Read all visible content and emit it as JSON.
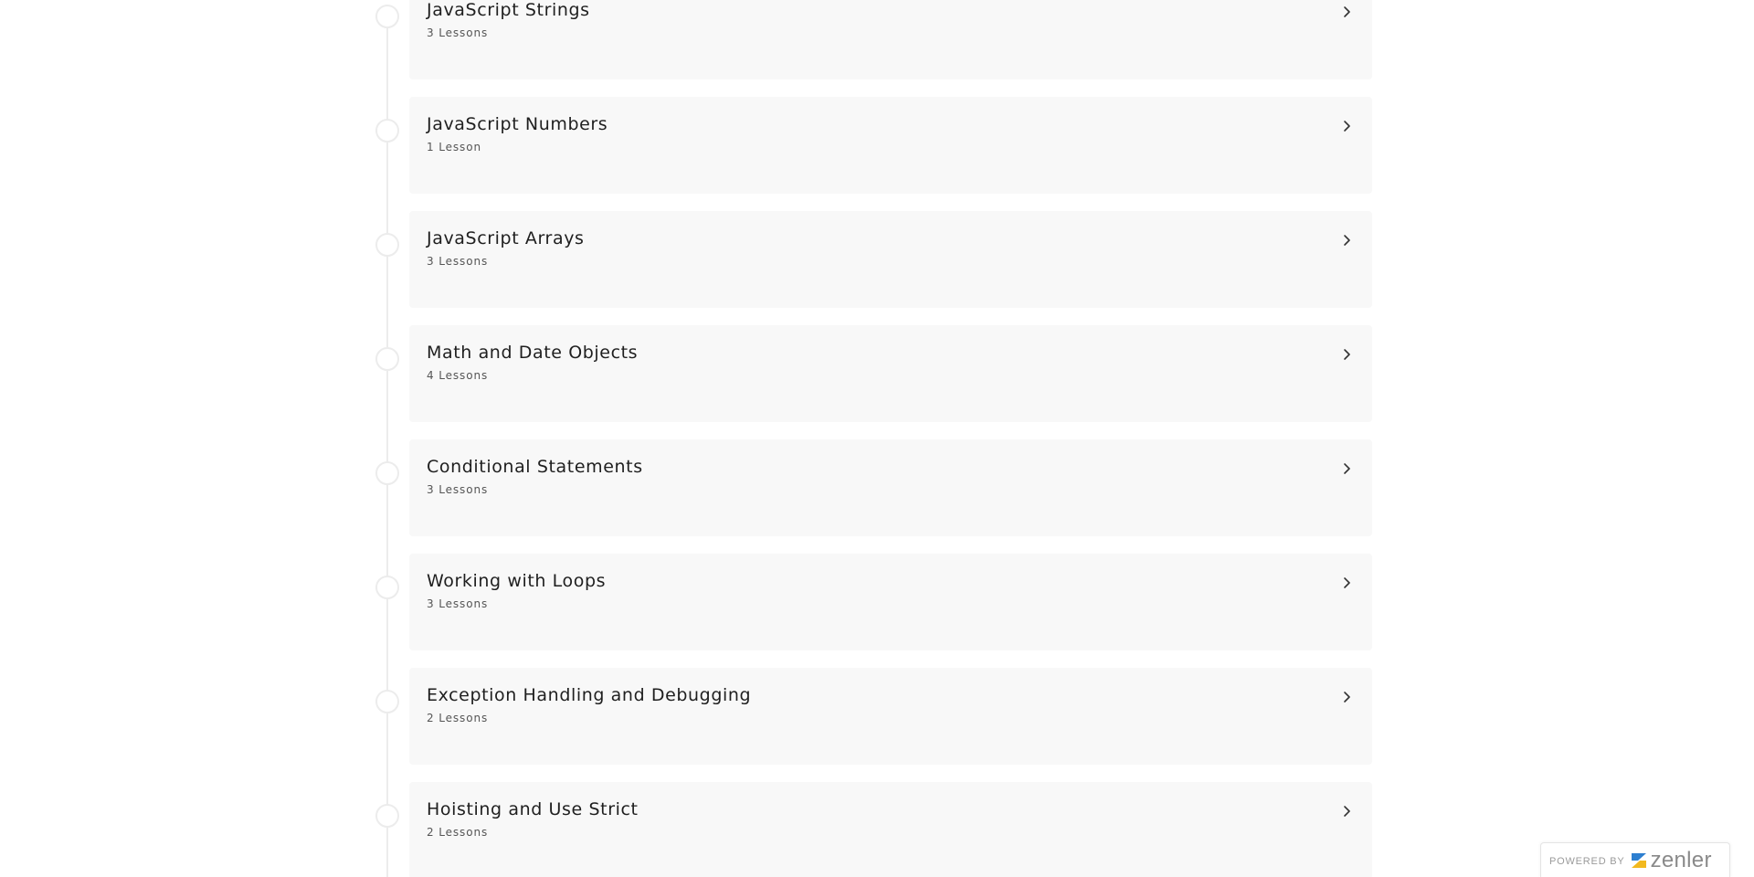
{
  "sections": [
    {
      "title": "JavaScript Strings",
      "count": "3 Lessons"
    },
    {
      "title": "JavaScript Numbers",
      "count": "1 Lesson"
    },
    {
      "title": "JavaScript Arrays",
      "count": "3 Lessons"
    },
    {
      "title": "Math and Date Objects",
      "count": "4 Lessons"
    },
    {
      "title": "Conditional Statements",
      "count": "3 Lessons"
    },
    {
      "title": "Working with Loops",
      "count": "3 Lessons"
    },
    {
      "title": "Exception Handling and Debugging",
      "count": "2 Lessons"
    },
    {
      "title": "Hoisting and Use Strict",
      "count": "2 Lessons"
    }
  ],
  "badge": {
    "powered_by": "POWERED BY",
    "brand": "zenler",
    "logo_icon": "zenler-logo-icon"
  },
  "icons": {
    "expand": "chevron-right-icon",
    "timeline": "timeline-dot"
  },
  "colors": {
    "card_background": "#f8f8f8",
    "timeline": "#ececec",
    "title_text": "#1f1f1f",
    "count_text": "#555555",
    "logo_blue": "#2d7fd0",
    "logo_yellow": "#f2b91f"
  }
}
